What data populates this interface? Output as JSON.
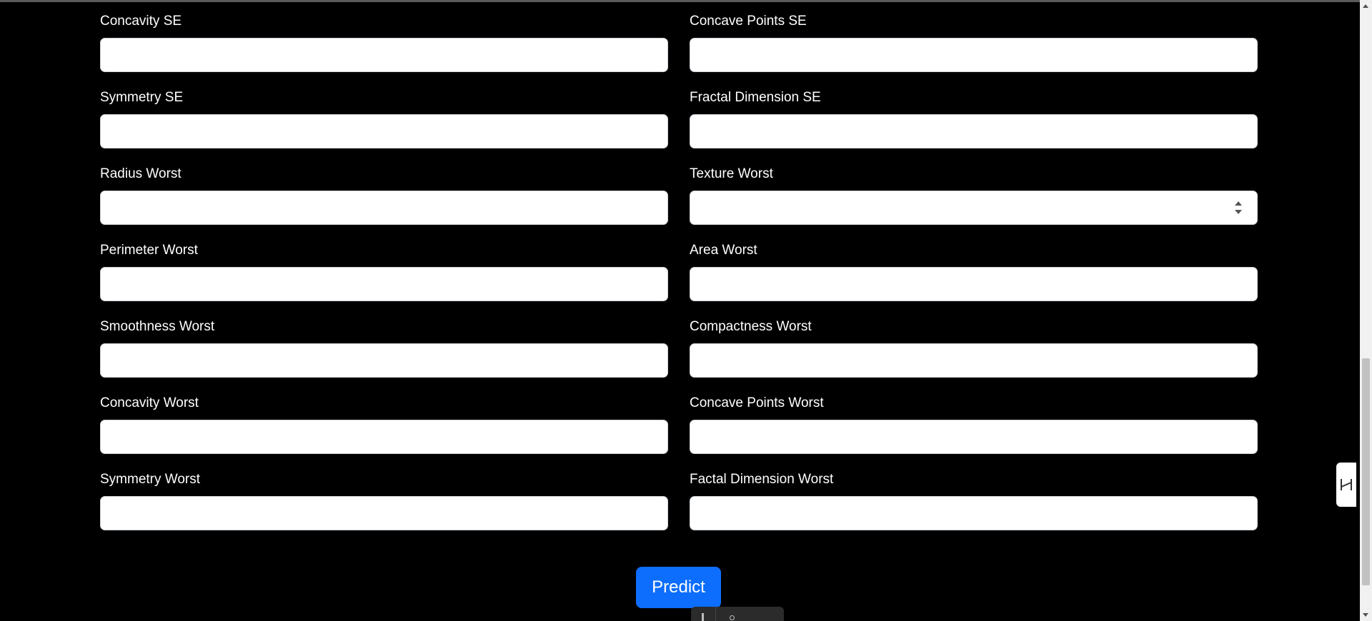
{
  "form": {
    "rows": [
      {
        "left": {
          "label": "Concavity SE",
          "value": ""
        },
        "right": {
          "label": "Concave Points SE",
          "value": ""
        }
      },
      {
        "left": {
          "label": "Symmetry SE",
          "value": ""
        },
        "right": {
          "label": "Fractal Dimension SE",
          "value": ""
        }
      },
      {
        "left": {
          "label": "Radius Worst",
          "value": ""
        },
        "right": {
          "label": "Texture Worst",
          "value": ""
        }
      },
      {
        "left": {
          "label": "Perimeter Worst",
          "value": ""
        },
        "right": {
          "label": "Area Worst",
          "value": ""
        }
      },
      {
        "left": {
          "label": "Smoothness Worst",
          "value": ""
        },
        "right": {
          "label": "Compactness Worst",
          "value": ""
        }
      },
      {
        "left": {
          "label": "Concavity Worst",
          "value": ""
        },
        "right": {
          "label": "Concave Points Worst",
          "value": ""
        }
      },
      {
        "left": {
          "label": "Symmetry Worst",
          "value": ""
        },
        "right": {
          "label": "Factal Dimension Worst",
          "value": ""
        }
      }
    ],
    "submit_label": "Predict"
  },
  "colors": {
    "background": "#000000",
    "accent": "#0d6efd",
    "label_text": "#ffffff"
  },
  "icons": {
    "side_tab": "sidebar-toggle-icon",
    "spinner": "number-spinner-icon"
  }
}
